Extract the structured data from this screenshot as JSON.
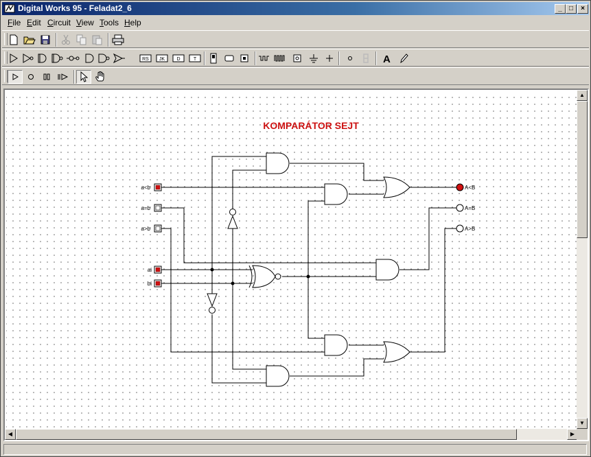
{
  "window": {
    "title": "Digital Works 95 - Feladat2_6",
    "controls": {
      "minimize": "_",
      "maximize": "□",
      "close": "×"
    }
  },
  "menubar": {
    "items": [
      {
        "label": "File",
        "accel": "F",
        "rest": "ile"
      },
      {
        "label": "Edit",
        "accel": "E",
        "rest": "dit"
      },
      {
        "label": "Circuit",
        "accel": "C",
        "rest": "ircuit"
      },
      {
        "label": "View",
        "accel": "V",
        "rest": "iew"
      },
      {
        "label": "Tools",
        "accel": "T",
        "rest": "ools"
      },
      {
        "label": "Help",
        "accel": "H",
        "rest": "elp"
      }
    ]
  },
  "toolbar_file": {
    "icons": [
      "new-file-icon",
      "open-folder-icon",
      "save-icon",
      "cut-icon",
      "copy-icon",
      "paste-icon",
      "print-icon"
    ]
  },
  "toolbar_components": {
    "icons": [
      "buffer-gate-icon",
      "not-gate-icon",
      "and-gate-icon",
      "nand-gate-icon",
      "or-gate-icon",
      "nor-gate-icon",
      "xor-gate-icon",
      "xnor-gate-icon",
      "rs-flipflop-icon",
      "jk-flipflop-icon",
      "d-flipflop-icon",
      "t-flipflop-icon",
      "sequence-icon",
      "led-icon",
      "input-switch-icon",
      "counter-icon",
      "clock-icon",
      "pulse-icon",
      "ground-icon",
      "plus-icon",
      "node-icon",
      "digit-display-icon",
      "text-icon",
      "pencil-icon"
    ],
    "chip_labels": {
      "rs": "RS",
      "jk": "JK",
      "d": "D",
      "t": "T"
    }
  },
  "toolbar_run": {
    "icons": [
      "play-icon",
      "stop-icon",
      "pause-icon",
      "step-icon",
      "pointer-icon",
      "hand-icon"
    ]
  },
  "circuit": {
    "title": "KOMPARÁTOR SEJT",
    "inputs": [
      {
        "label": "a<b",
        "active": true
      },
      {
        "label": "a=b",
        "active": false
      },
      {
        "label": "a>b",
        "active": false
      },
      {
        "label": "ai",
        "active": true
      },
      {
        "label": "bi",
        "active": true
      }
    ],
    "outputs": [
      {
        "label": "A<B",
        "active": true
      },
      {
        "label": "A=B",
        "active": false
      },
      {
        "label": "A>B",
        "active": false
      }
    ],
    "colors": {
      "active": "#d01010",
      "title": "#cc1111",
      "wire": "#000000"
    }
  }
}
